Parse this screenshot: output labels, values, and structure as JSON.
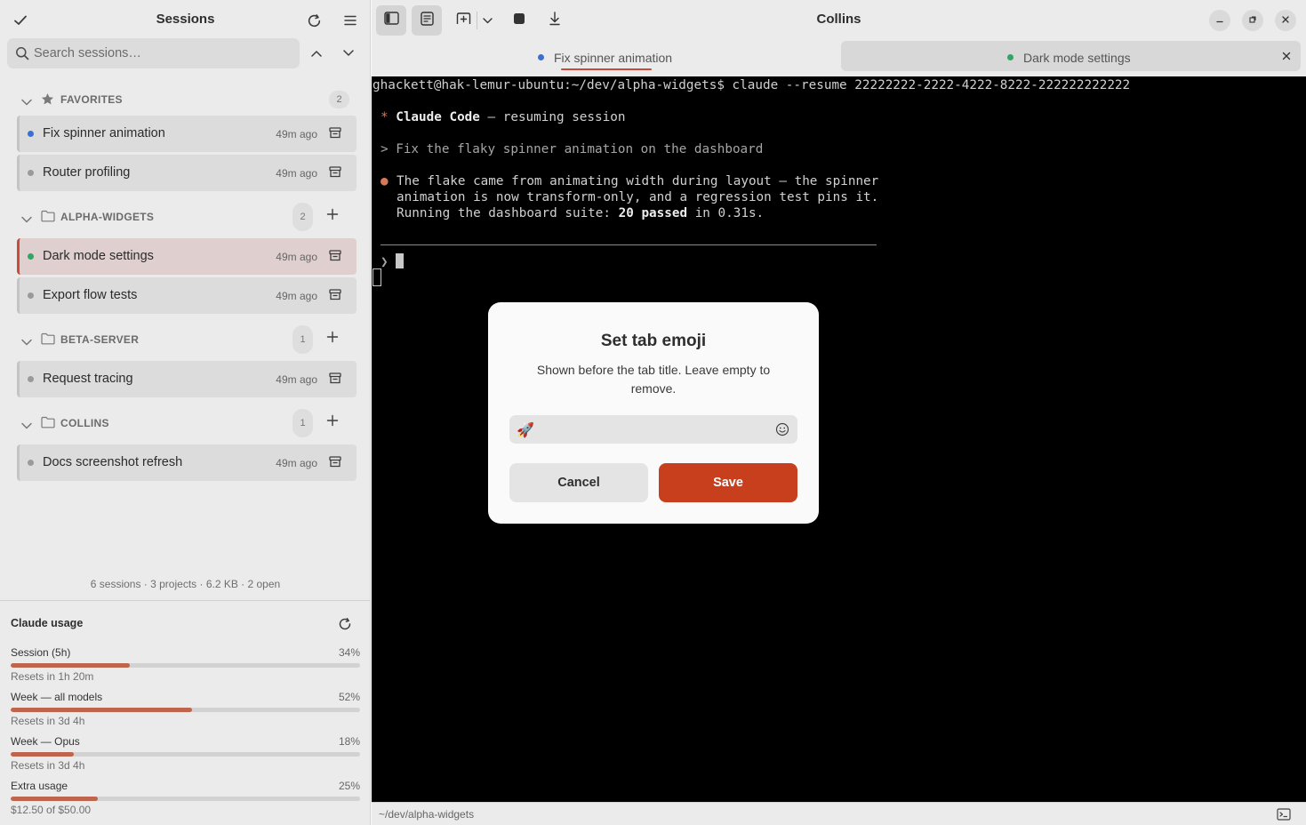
{
  "sidebar": {
    "title": "Sessions",
    "search": {
      "placeholder": "Search sessions…",
      "value": ""
    },
    "groups": [
      {
        "name": "FAVORITES",
        "count": "2",
        "icon": "star-icon",
        "sessions": [
          {
            "name": "Fix spinner animation",
            "time": "49m ago",
            "dot": "#3b6fd4"
          },
          {
            "name": "Router profiling",
            "time": "49m ago",
            "dot": "#9a9a9a"
          }
        ]
      },
      {
        "name": "ALPHA-WIDGETS",
        "count": "2",
        "icon": "folder-icon",
        "sessions": [
          {
            "name": "Dark mode settings",
            "time": "49m ago",
            "dot": "#2fa566"
          },
          {
            "name": "Export flow tests",
            "time": "49m ago",
            "dot": "#9a9a9a"
          }
        ]
      },
      {
        "name": "BETA-SERVER",
        "count": "1",
        "icon": "folder-icon",
        "sessions": [
          {
            "name": "Request tracing",
            "time": "49m ago",
            "dot": "#9a9a9a"
          }
        ]
      },
      {
        "name": "COLLINS",
        "count": "1",
        "icon": "folder-icon",
        "sessions": [
          {
            "name": "Docs screenshot refresh",
            "time": "49m ago",
            "dot": "#9a9a9a"
          }
        ]
      }
    ],
    "stats": "6 sessions · 3 projects · 6.2 KB · 2 open"
  },
  "usage": {
    "title": "Claude usage",
    "rows": [
      {
        "label": "Session (5h)",
        "pct": "34%",
        "fraction": 0.34,
        "note": "Resets in 1h 20m"
      },
      {
        "label": "Week — all models",
        "pct": "52%",
        "fraction": 0.52,
        "note": "Resets in 3d 4h"
      },
      {
        "label": "Week — Opus",
        "pct": "18%",
        "fraction": 0.18,
        "note": "Resets in 3d 4h"
      },
      {
        "label": "Extra usage",
        "pct": "25%",
        "fraction": 0.25,
        "note": "$12.50 of $50.00"
      }
    ]
  },
  "window": {
    "title": "Collins"
  },
  "tabs": [
    {
      "label": "Fix spinner animation",
      "dot": "#3b6fd4",
      "active": true
    },
    {
      "label": "Dark mode settings",
      "dot": "#2fa566",
      "active": false
    }
  ],
  "terminal": {
    "prompt_line": "ghackett@hak-lemur-ubuntu:~/dev/alpha-widgets$ claude --resume 22222222-2222-4222-8222-222222222222",
    "header_star": "*",
    "header_bold": "Claude Code",
    "header_rest": " — resuming session",
    "user_msg": "> Fix the flaky spinner animation on the dashboard",
    "reply_dot": "●",
    "reply_1": "The flake came from animating width during layout — the spinner",
    "reply_2": "animation is now transform-only, and a regression test pins it.",
    "reply_3a": "Running the dashboard suite: ",
    "reply_3b": "20 passed",
    "reply_3c": " in 0.31s.",
    "input_prompt": "❯"
  },
  "statusbar": {
    "path": "~/dev/alpha-widgets"
  },
  "dialog": {
    "title": "Set tab emoji",
    "body": "Shown before the tab title. Leave empty to remove.",
    "input_value": "🚀",
    "cancel": "Cancel",
    "save": "Save"
  },
  "colors": {
    "accent": "#c83f1e",
    "usage_bar": "#c0654d",
    "active_session": "#e0cfcf"
  }
}
